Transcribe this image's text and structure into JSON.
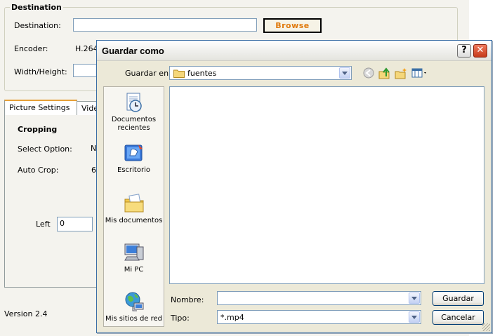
{
  "app": {
    "destination_group": {
      "legend": "Destination"
    },
    "destination_label": "Destination:",
    "destination_value": "",
    "browse_label": "Browse",
    "encoder_label": "Encoder:",
    "encoder_value": "H.264",
    "width_height_label": "Width/Height:",
    "tabs": [
      {
        "label": "Picture Settings"
      },
      {
        "label": "Vide"
      }
    ],
    "cropping_heading": "Cropping",
    "select_option_label": "Select Option:",
    "select_option_value": "N",
    "auto_crop_label": "Auto Crop:",
    "auto_crop_value": "6",
    "left_label": "Left",
    "left_value": "0",
    "version": "Version 2.4"
  },
  "dialog": {
    "title": "Guardar como",
    "help_glyph": "?",
    "close_glyph": "✕",
    "save_in_label": "Guardar en:",
    "save_in_value": "fuentes",
    "places": [
      {
        "label_line1": "Documentos",
        "label_line2": "recientes",
        "icon": "recent-documents-icon"
      },
      {
        "label_line1": "Escritorio",
        "label_line2": "",
        "icon": "desktop-icon"
      },
      {
        "label_line1": "Mis documentos",
        "label_line2": "",
        "icon": "my-documents-icon"
      },
      {
        "label_line1": "Mi PC",
        "label_line2": "",
        "icon": "my-computer-icon"
      },
      {
        "label_line1": "Mis sitios de red",
        "label_line2": "",
        "icon": "network-places-icon"
      }
    ],
    "filename_label": "Nombre:",
    "filename_value": "",
    "filetype_label": "Tipo:",
    "filetype_value": "*.mp4",
    "save_button": "Guardar",
    "cancel_button": "Cancelar"
  }
}
